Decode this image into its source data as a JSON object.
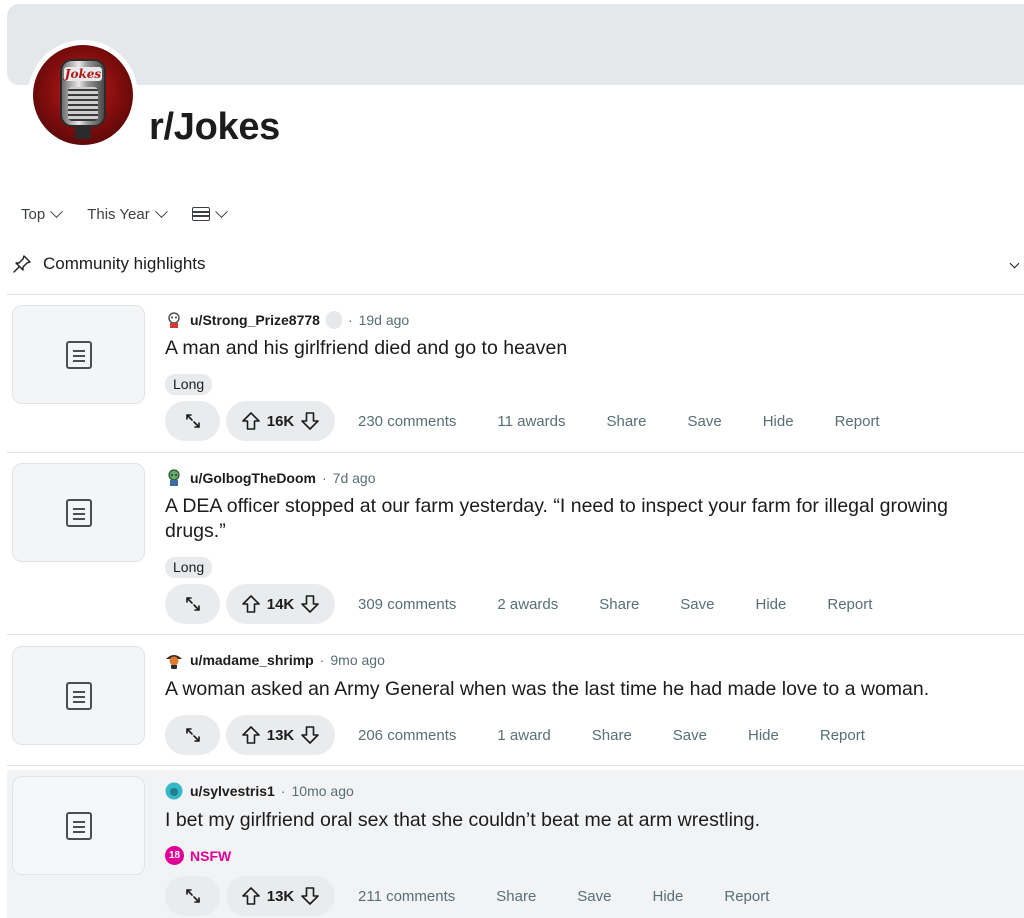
{
  "subreddit": {
    "name": "r/Jokes",
    "icon_text": "Jokes"
  },
  "sort": {
    "primary": "Top",
    "range": "This Year",
    "layout_icon": "layout-card-icon"
  },
  "highlights": {
    "label": "Community highlights"
  },
  "posts": [
    {
      "user": "u/Strong_Prize8778",
      "time": "19d ago",
      "title": "A man and his girlfriend died and go to heaven",
      "tag": "Long",
      "votes": "16K",
      "comments": "230 comments",
      "awards": "11 awards",
      "share": "Share",
      "save": "Save",
      "hide": "Hide",
      "report": "Report"
    },
    {
      "user": "u/GolbogTheDoom",
      "time": "7d ago",
      "title": "A DEA officer stopped at our farm yesterday. “I need to inspect your farm for illegal growing drugs.”",
      "tag": "Long",
      "votes": "14K",
      "comments": "309 comments",
      "awards": "2 awards",
      "share": "Share",
      "save": "Save",
      "hide": "Hide",
      "report": "Report"
    },
    {
      "user": "u/madame_shrimp",
      "time": "9mo ago",
      "title": "A woman asked an Army General when was the last time he had made love to a woman.",
      "votes": "13K",
      "comments": "206 comments",
      "awards": "1 award",
      "share": "Share",
      "save": "Save",
      "hide": "Hide",
      "report": "Report"
    },
    {
      "user": "u/sylvestris1",
      "time": "10mo ago",
      "title": "I bet my girlfriend oral sex that she couldn’t beat me at arm wrestling.",
      "nsfw_badge": "18",
      "nsfw_label": "NSFW",
      "votes": "13K",
      "comments": "211 comments",
      "share": "Share",
      "save": "Save",
      "hide": "Hide",
      "report": "Report"
    }
  ],
  "colors": {
    "banner": "#e5e8eb",
    "nsfw": "#e00096",
    "meta_text": "#576f76",
    "pill_bg": "#e9ebed"
  }
}
